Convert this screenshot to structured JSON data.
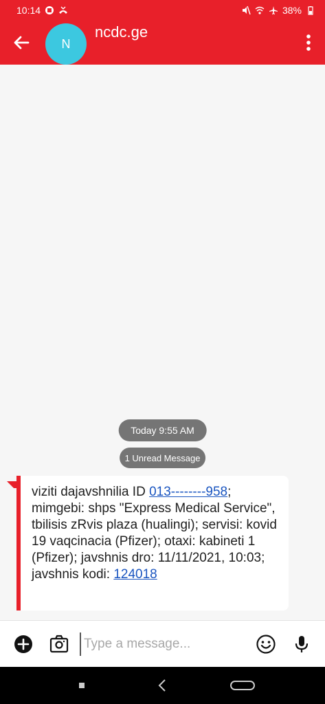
{
  "status_bar": {
    "time": "10:14",
    "battery": "38%"
  },
  "header": {
    "avatar_letter": "N",
    "contact_name": "ncdc.ge"
  },
  "conversation": {
    "timestamp_chip": "Today 9:55 AM",
    "unread_chip": "1 Unread Message",
    "message": {
      "line1_text": "viziti dajavshnilia ID ",
      "id_link": "013--------958",
      "line1_end": ";",
      "body": "mimgebi: shps \"Express Medical Service\", tbilisis zRvis plaza (hualingi); servisi: kovid 19 vaqcinacia (Pfizer); otaxi: kabineti 1 (Pfizer); javshnis dro: 11/11/2021, 10:03; javshnis kodi: ",
      "code_link": "124018"
    }
  },
  "compose": {
    "placeholder": "Type a message..."
  },
  "colors": {
    "accent": "#e8202a",
    "avatar": "#3cc8e0",
    "chip": "#757575",
    "link": "#1a55c0"
  },
  "icons": {
    "status_left": [
      "photo-notification-icon",
      "missed-call-icon"
    ],
    "status_right": [
      "mute-icon",
      "wifi-calling-icon",
      "airplane-icon",
      "battery-icon"
    ],
    "header": [
      "back-arrow-icon",
      "overflow-menu-icon"
    ],
    "compose": [
      "add-icon",
      "camera-icon",
      "emoji-icon",
      "mic-icon"
    ],
    "nav": [
      "recents-icon",
      "back-icon",
      "home-icon"
    ]
  }
}
